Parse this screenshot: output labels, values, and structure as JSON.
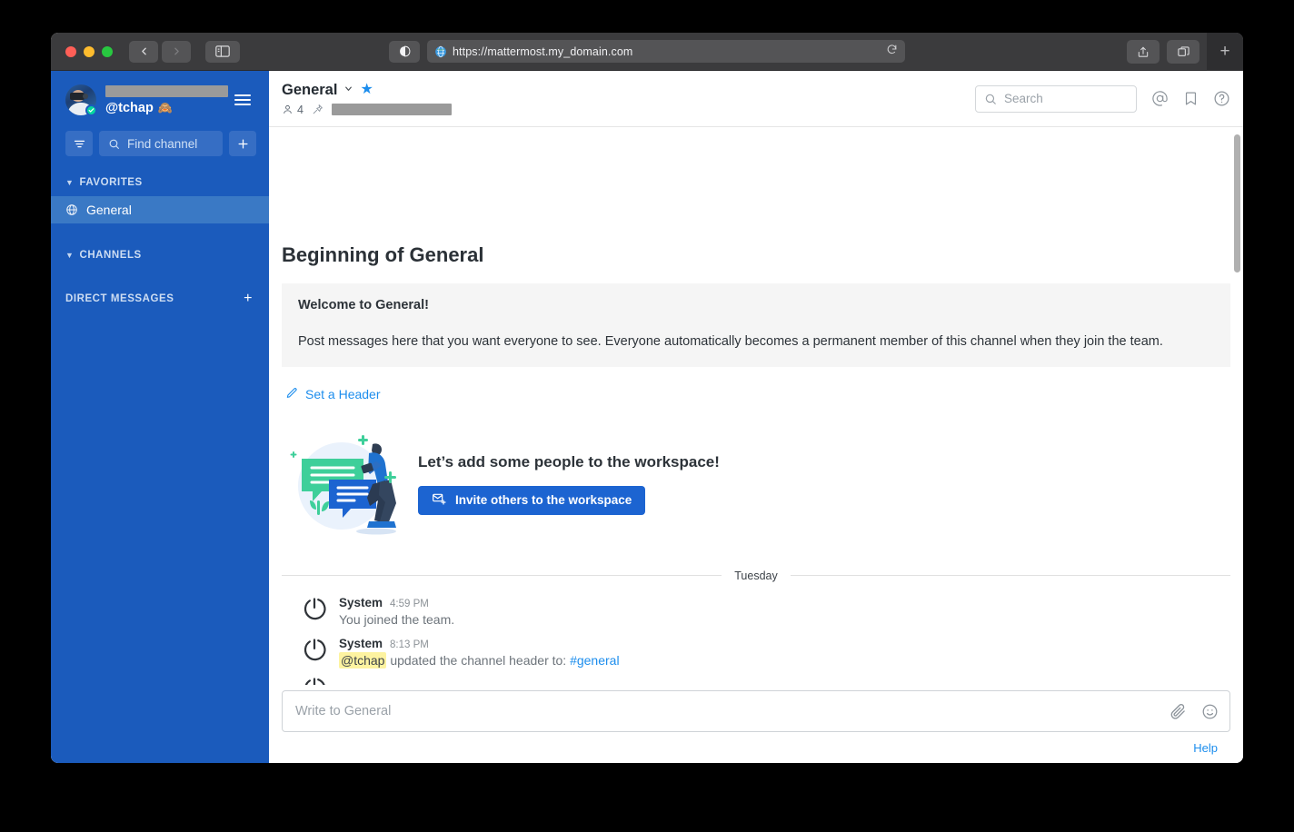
{
  "browser": {
    "url": "https://mattermost.my_domain.com",
    "nav": {
      "back_label": "Back",
      "forward_label": "Forward",
      "sidebar_toggle_label": "Show sidebar",
      "reader_label": "Reader view",
      "reload_label": "Reload",
      "share_label": "Share",
      "tabs_label": "Tab overview",
      "newtab_label": "+"
    }
  },
  "sidebar": {
    "team_name_redacted": "",
    "username": "@tchap",
    "user_emoji": "🙈",
    "find_channel_placeholder": "Find channel",
    "filter_label": "Filter",
    "add_channel_label": "+",
    "categories": [
      {
        "label": "FAVORITES",
        "collapsed": false
      },
      {
        "label": "CHANNELS",
        "collapsed": false
      },
      {
        "label": "DIRECT MESSAGES",
        "collapsed": false,
        "add_label": "+"
      }
    ],
    "favorites": [
      {
        "name": "General",
        "icon": "globe-icon",
        "active": true
      }
    ],
    "channels": [],
    "direct_messages": []
  },
  "channel_header": {
    "title": "General",
    "dropdown_icon": "chevron-down-icon",
    "favorite_icon": "star-icon",
    "member_count": "4",
    "pin_label": "Pinned messages",
    "header_text_redacted": ""
  },
  "header_actions": {
    "search_placeholder": "Search",
    "mentions_label": "@",
    "saved_label": "Saved posts",
    "help_label": "Help"
  },
  "main": {
    "intro_title": "Beginning of General",
    "welcome_title": "Welcome to General!",
    "welcome_body": "Post messages here that you want everyone to see. Everyone automatically becomes a permanent member of this channel when they join the team.",
    "set_header_label": "Set a Header",
    "invite_heading": "Let’s add some people to the workspace!",
    "invite_button_label": "Invite others to the workspace",
    "date_separator": "Tuesday",
    "messages": [
      {
        "user": "System",
        "time": "4:59 PM",
        "text_prefix": "You joined the team.",
        "highlight": "",
        "text_middle": "",
        "link": ""
      },
      {
        "user": "System",
        "time": "8:13 PM",
        "text_prefix": "",
        "highlight": "@tchap",
        "text_middle": " updated the channel header to: ",
        "link": "#general"
      }
    ]
  },
  "composer": {
    "placeholder": "Write to General",
    "attach_label": "Attach file",
    "emoji_label": "Emoji picker"
  },
  "footer": {
    "help_label": "Help"
  },
  "colors": {
    "sidebar_bg": "#1b5bbc",
    "sidebar_active": "#3a79c5",
    "accent_blue": "#1c8ded",
    "button_blue": "#1c64d1",
    "titlebar": "#3b3b3d",
    "highlight_yellow": "#fdf3a0"
  }
}
